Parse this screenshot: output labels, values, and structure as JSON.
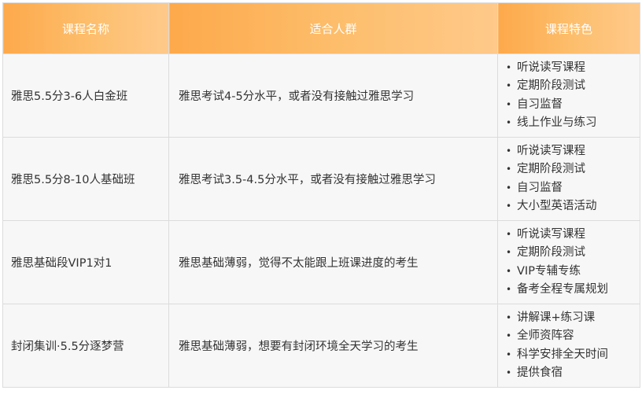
{
  "header": {
    "col_name": "课程名称",
    "col_audience": "适合人群",
    "col_features": "课程特色"
  },
  "rows": [
    {
      "name": "雅思5.5分3-6人白金班",
      "audience": "雅思考试4-5分水平，或者没有接触过雅思学习",
      "features": [
        "听说读写课程",
        "定期阶段测试",
        "自习监督",
        "线上作业与练习"
      ]
    },
    {
      "name": "雅思5.5分8-10人基础班",
      "audience": "雅思考试3.5-4.5分水平，或者没有接触过雅思学习",
      "features": [
        "听说读写课程",
        "定期阶段测试",
        "自习监督",
        "大小型英语活动"
      ]
    },
    {
      "name": "雅思基础段VIP1对1",
      "audience": "雅思基础薄弱，觉得不太能跟上班课进度的考生",
      "features": [
        "听说读写课程",
        "定期阶段测试",
        "VIP专辅专练",
        "备考全程专属规划"
      ]
    },
    {
      "name": "封闭集训·5.5分逐梦营",
      "audience": "雅思基础薄弱，想要有封闭环境全天学习的考生",
      "features": [
        "讲解课+练习课",
        "全师资阵容",
        "科学安排全天时间",
        "提供食宿"
      ]
    }
  ],
  "bullet_glyph": "•"
}
